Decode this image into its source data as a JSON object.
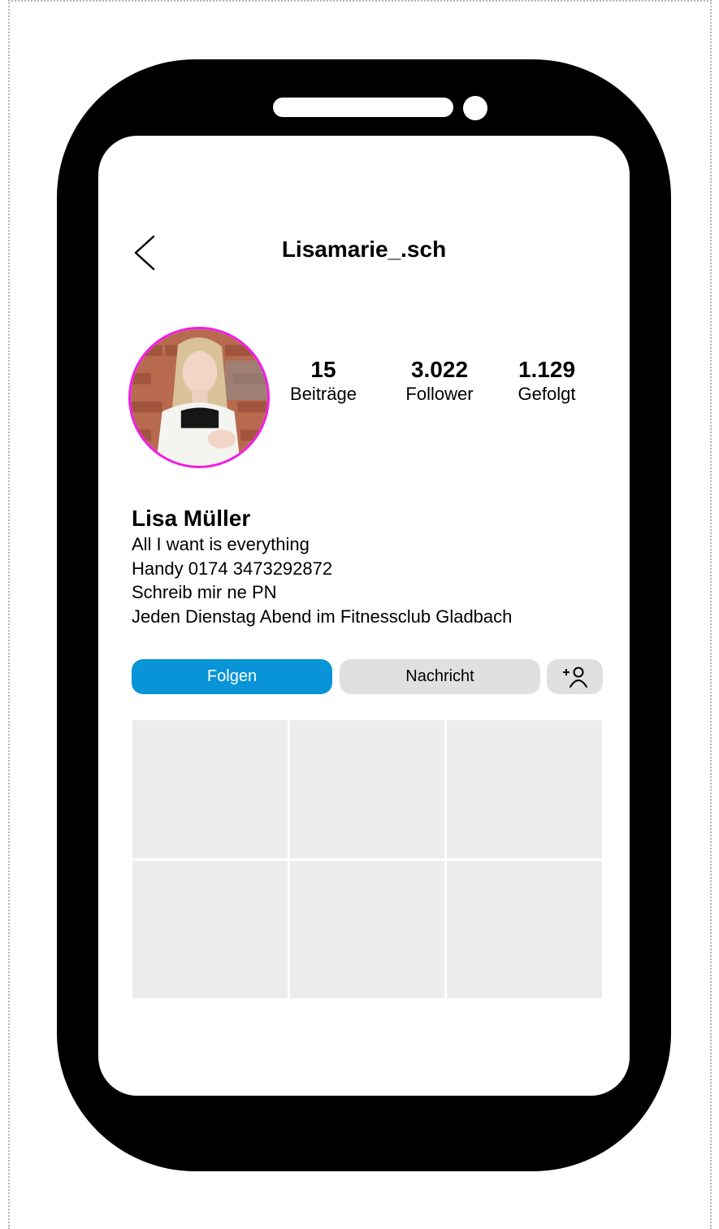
{
  "header": {
    "username": "Lisamarie_.sch",
    "back_icon": "chevron-left-icon"
  },
  "profile": {
    "avatar_ring_color": "#f21ce6",
    "stats": [
      {
        "value": "15",
        "label": "Beiträge"
      },
      {
        "value": "3.022",
        "label": "Follower"
      },
      {
        "value": "1.129",
        "label": "Gefolgt"
      }
    ]
  },
  "bio": {
    "name": "Lisa Müller",
    "lines": [
      "All I want is everything",
      "Handy 0174 3473292872",
      "Schreib mir ne PN",
      "Jeden Dienstag Abend im Fitnessclub Gladbach"
    ]
  },
  "actions": {
    "follow_label": "Folgen",
    "follow_color": "#0894d6",
    "message_label": "Nachricht",
    "add_user_icon": "add-user-icon"
  },
  "posts_grid": {
    "cell_count": 6,
    "cell_color": "#ececec"
  }
}
